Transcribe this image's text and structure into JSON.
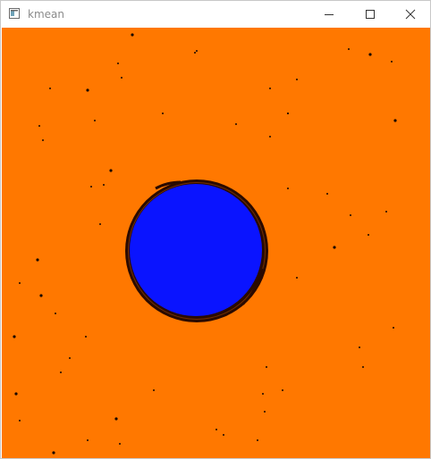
{
  "window": {
    "title": "kmean",
    "icon": "opencv-window-icon",
    "controls": [
      "minimize-icon",
      "maximize-icon",
      "close-icon"
    ]
  },
  "image": {
    "background_color": "#ff7800",
    "circle_fill_color": "#0a14ff",
    "outline_color": "#2a0a00"
  }
}
